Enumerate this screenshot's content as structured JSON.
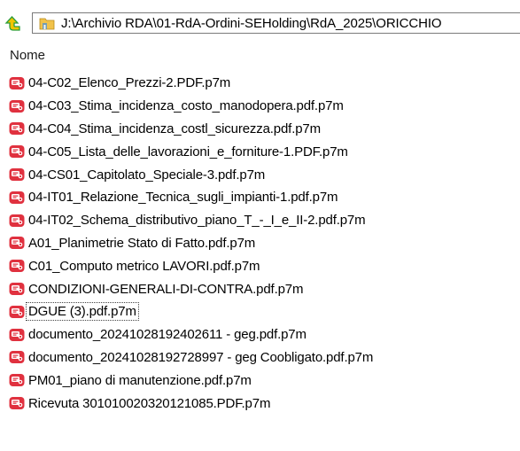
{
  "window": {
    "title": ""
  },
  "pathbar": {
    "path": "J:\\Archivio RDA\\01-RdA-Ordini-SEHolding\\RdA_2025\\ORICCHIO"
  },
  "columns": {
    "name_header": "Nome"
  },
  "files": [
    {
      "name": "04-C02_Elenco_Prezzi-2.PDF.p7m"
    },
    {
      "name": "04-C03_Stima_incidenza_costo_manodopera.pdf.p7m"
    },
    {
      "name": "04-C04_Stima_incidenza_costl_sicurezza.pdf.p7m"
    },
    {
      "name": "04-C05_Lista_delle_lavorazioni_e_forniture-1.PDF.p7m"
    },
    {
      "name": "04-CS01_Capitolato_Speciale-3.pdf.p7m"
    },
    {
      "name": "04-IT01_Relazione_Tecnica_sugli_impianti-1.pdf.p7m"
    },
    {
      "name": "04-IT02_Schema_distributivo_piano_T_-_I_e_II-2.pdf.p7m"
    },
    {
      "name": "A01_Planimetrie Stato di Fatto.pdf.p7m"
    },
    {
      "name": "C01_Computo metrico LAVORI.pdf.p7m"
    },
    {
      "name": "CONDIZIONI-GENERALI-DI-CONTRA.pdf.p7m"
    },
    {
      "name": "DGUE (3).pdf.p7m"
    },
    {
      "name": "documento_20241028192402611 - geg.pdf.p7m"
    },
    {
      "name": "documento_20241028192728997 - geg Coobligato.pdf.p7m"
    },
    {
      "name": "PM01_piano di manutenzione.pdf.p7m"
    },
    {
      "name": "Ricevuta 301010020320121085.PDF.p7m"
    }
  ],
  "focused_index": 10,
  "colors": {
    "icon_red": "#e0313f",
    "folder_yellow": "#f1c24a",
    "up_arrow_green": "#2a9d3a",
    "up_arrow_yellow": "#f2c400"
  },
  "icons": {
    "up": "up-arrow-icon",
    "folder": "folder-icon",
    "file": "signed-pdf-icon"
  }
}
